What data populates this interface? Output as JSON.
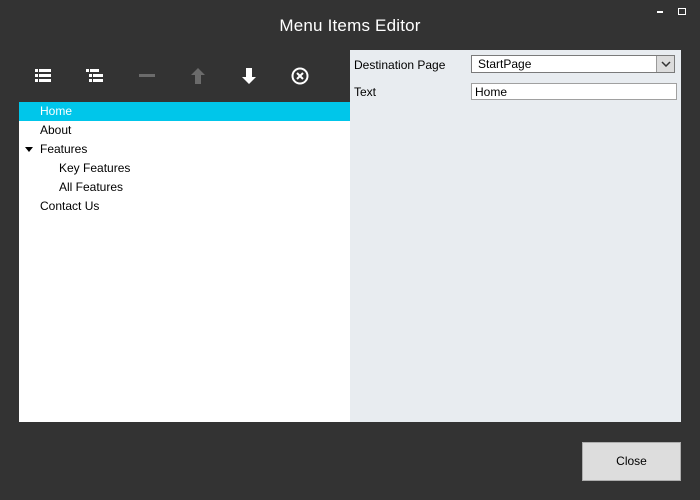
{
  "window": {
    "title": "Menu Items Editor"
  },
  "toolbar": {
    "buttons": [
      {
        "icon": "add-item-icon",
        "enabled": true
      },
      {
        "icon": "add-child-item-icon",
        "enabled": true
      },
      {
        "icon": "remove-icon",
        "enabled": false
      },
      {
        "icon": "move-up-icon",
        "enabled": false
      },
      {
        "icon": "move-down-icon",
        "enabled": true
      },
      {
        "icon": "delete-icon",
        "enabled": true
      }
    ]
  },
  "tree": {
    "items": [
      {
        "label": "Home",
        "level": 0,
        "selected": true,
        "expandable": false
      },
      {
        "label": "About",
        "level": 0,
        "selected": false,
        "expandable": false
      },
      {
        "label": "Features",
        "level": 0,
        "selected": false,
        "expandable": true,
        "expanded": true
      },
      {
        "label": "Key Features",
        "level": 1,
        "selected": false,
        "expandable": false
      },
      {
        "label": "All Features",
        "level": 1,
        "selected": false,
        "expandable": false
      },
      {
        "label": "Contact Us",
        "level": 0,
        "selected": false,
        "expandable": false
      }
    ]
  },
  "properties": {
    "destination_label": "Destination Page",
    "destination_value": "StartPage",
    "text_label": "Text",
    "text_value": "Home"
  },
  "footer": {
    "close_label": "Close"
  },
  "colors": {
    "background": "#333333",
    "selection": "#00c6ea",
    "props_panel": "#e8ecf0",
    "tree_panel": "#ffffff"
  }
}
